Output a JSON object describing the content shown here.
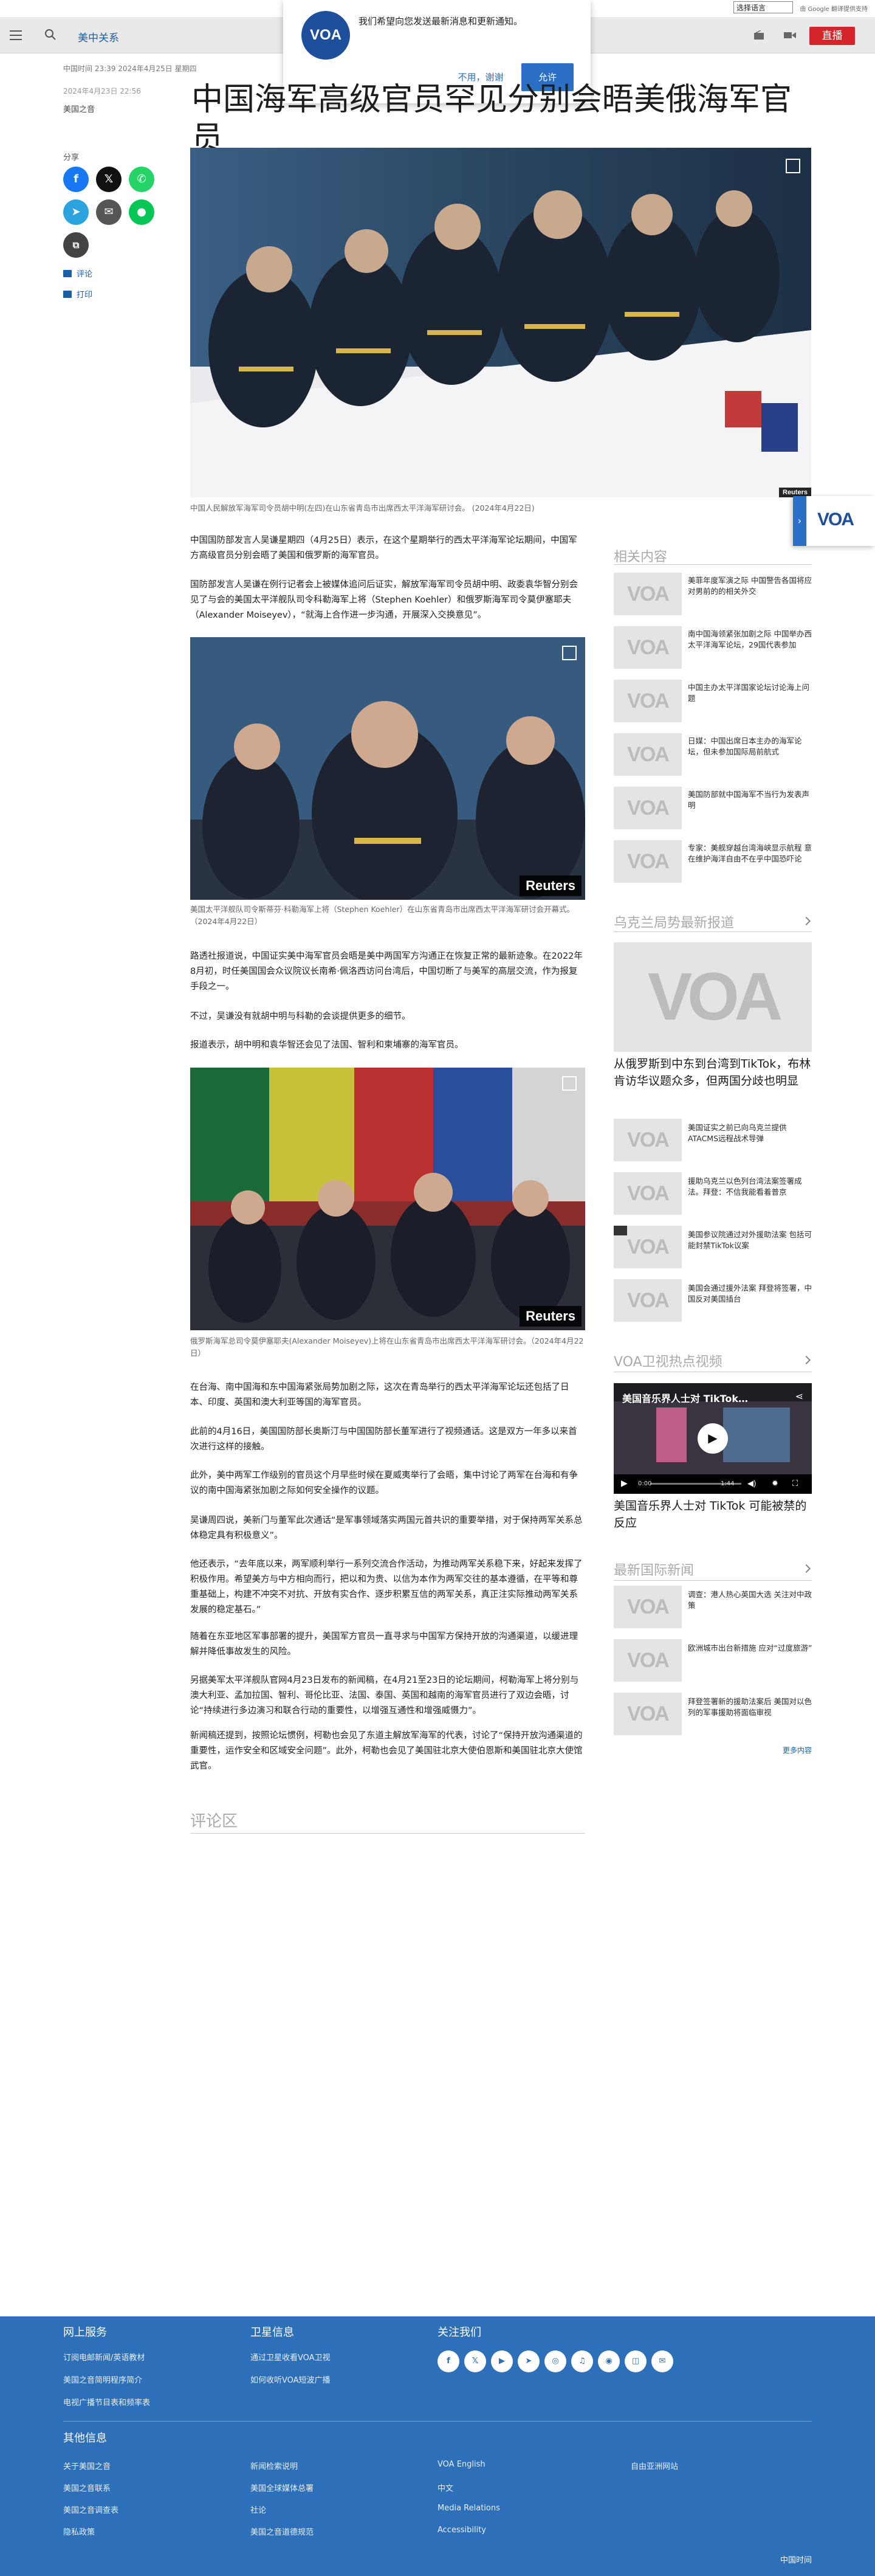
{
  "translate": {
    "select_value": "选择语言",
    "powered_text": "由 Google 翻译提供支持"
  },
  "header": {
    "section": "美中关系",
    "live_label": "直播",
    "hamburger_icon": "menu-icon",
    "search_icon": "search-icon"
  },
  "push_popup": {
    "message": "我们希望向您发送最新消息和更新通知。",
    "logo_text": "VOA",
    "deny_label": "不用，谢谢",
    "allow_label": "允许"
  },
  "article": {
    "time_line": "中国时间 23:39 2024年4月25日 星期四",
    "updated": "2024年4月23日 22:56",
    "source": "美国之音",
    "title": "中国海军高级官员罕见分别会晤美俄海军官员",
    "share_label": "分享",
    "comment_label": "评论",
    "print_label": "打印",
    "hero_caption": "中国人民解放军海军司令员胡中明(左四)在山东省青岛市出席西太平洋海军研讨会。 (2024年4月22日)",
    "paragraphs_1": [
      "中国国防部发言人吴谦星期四（4月25日）表示，在这个星期举行的西太平洋海军论坛期间，中国军方高级官员分别会晤了美国和俄罗斯的海军官员。",
      "国防部发言人吴谦在例行记者会上被媒体追问后证实，解放军海军司令员胡中明、政委袁华智分别会见了与会的美国太平洋舰队司令科勒海军上将（Stephen Koehler）和俄罗斯海军司令莫伊塞耶夫（Alexander Moiseyev），“就海上合作进一步沟通，开展深入交换意见”。"
    ],
    "image2_caption": "美国太平洋舰队司令斯蒂芬·科勒海军上将（Stephen Koehler）在山东省青岛市出席西太平洋海军研讨会开幕式。（2024年4月22日）",
    "reuters_label": "Reuters",
    "paragraphs_2": [
      "路透社报道说，中国证实美中海军官员会晤是美中两国军方沟通正在恢复正常的最新迹象。在2022年8月初，时任美国国会众议院议长南希·佩洛西访问台湾后，中国切断了与美军的高层交流，作为报复手段之一。",
      "不过，吴谦没有就胡中明与科勒的会谈提供更多的细节。",
      "报道表示，胡中明和袁华智还会见了法国、智利和柬埔寨的海军官员。"
    ],
    "image3_caption": "俄罗斯海军总司令莫伊塞耶夫(Alexander Moiseyev)上将在山东省青岛市出席西太平洋海军研讨会。（2024年4月22日）",
    "paragraphs_3": [
      "在台海、南中国海和东中国海紧张局势加剧之际，这次在青岛举行的西太平洋海军论坛还包括了日本、印度、英国和澳大利亚等国的海军官员。",
      "此前的4月16日，美国国防部长奥斯汀与中国国防部长董军进行了视频通话。这是双方一年多以来首次进行这样的接触。",
      "此外，美中两军工作级别的官员这个月早些时候在夏威夷举行了会晤，集中讨论了两军在台海和有争议的南中国海紧张加剧之际如何安全操作的议题。",
      "吴谦周四说，美新门与董军此次通话“是军事领域落实两国元首共识的重要举措，对于保持两军关系总体稳定具有积极意义”。",
      "他还表示，“去年底以来，两军顺利举行一系列交流合作活动，为推动两军关系稳下来，好起来发挥了积极作用。希望美方与中方相向而行，把以和为贵、以信为本作为两军交往的基本遵循，在平等和尊重基础上，构建不冲突不对抗、开放有实合作、逐步积累互信的两军关系，真正注实际推动两军关系发展的稳定基石。”",
      "随着在东亚地区军事部署的提升，美国军方官员一直寻求与中国军方保持开放的沟通渠道，以缓进理解并降低事故发生的风险。",
      "另据美军太平洋舰队官网4月23日发布的新闻稿，在4月21至23日的论坛期间，柯勒海军上将分别与澳大利亚、孟加拉国、智利、哥伦比亚、法国、泰国、英国和越南的海军官员进行了双边会晤，讨论“持续进行多边演习和联合行动的重要性，以增强互通性和增强威慑力”。",
      "新闻稿还提到，按照论坛惯例，柯勒也会见了东道主解放军海军的代表，讨论了“保持开放沟通渠道的重要性，运作安全和区域安全问题”。此外，柯勒也会见了美国驻北京大使伯恩斯和美国驻北京大使馆武官。"
    ],
    "comments_title": "评论区"
  },
  "rail": {
    "related_heading": "相关内容",
    "related": [
      "美菲年度军演之际 中国警告各国将应对男前的的相关外交",
      "南中国海领紧张加剧之际 中国举办西太平洋海军论坛，29国代表参加",
      "中国主办太平洋国家论坛讨论海上问题",
      "日媒：中国出席日本主办的海军论坛，但未参加国际局前航式",
      "美国防部就中国海军不当行为发表声明",
      "专家：美舰穿越台湾海峡显示航程 意在维护海洋自由不在乎中国恐吓论"
    ],
    "ukraine_heading": "乌克兰局势最新报道",
    "ukraine_big_title": "从俄罗斯到中东到台湾到TikTok，布林肯访华议题众多，但两国分歧也明显",
    "ukraine_items": [
      "美国证实之前已向乌克兰提供ATACMS远程战术导弹",
      "援助乌克兰以色列台湾法案签署成法。拜登：不信我能看着普京",
      "美国参议院通过对外援助法案 包括可能封禁TikTok议案",
      "美国会通过援外法案 拜登将签署，中国反对美国插台"
    ],
    "video_heading": "VOA卫视热点视频",
    "video_title_overlay": "美国音乐界人士对 TikTok…",
    "video_time": "0:00",
    "video_duration": "1:44",
    "video_caption": "美国音乐界人士对 TikTok 可能被禁的反应",
    "intl_heading": "最新国际新闻",
    "intl_items": [
      "调查：港人热心英国大选 关注对中政策",
      "欧洲城市出台新措施 应对“过度旅游”",
      "拜登签署新的援助法案后 美国对以色列的军事援助将面临审视"
    ],
    "more_label": "更多内容"
  },
  "side_tab": {
    "logo": "VOA",
    "arrow": "›"
  },
  "footer": {
    "col1_heading": "网上服务",
    "col1_links": [
      "订阅电邮新闻/英语教材",
      "美国之音简明程序简介",
      "电视广播节目表和频率表"
    ],
    "col2_heading": "卫星信息",
    "col2_links": [
      "通过卫星收看VOA卫视",
      "如何收听VOA短波广播"
    ],
    "col3_heading": "关注我们",
    "social_icons": [
      "facebook-icon",
      "x-icon",
      "youtube-icon",
      "telegram-icon",
      "instagram-icon",
      "podcast-icon",
      "rss-icon",
      "app-icon",
      "email-icon"
    ],
    "other_heading": "其他信息",
    "other_links": [
      [
        "关于美国之音",
        "美国之音联系",
        "美国之音调查表",
        "隐私政策"
      ],
      [
        "新闻检索说明",
        "美国全球媒体总署",
        "社论",
        "美国之音道德规范"
      ],
      [
        "VOA English",
        "中文",
        "Media Relations",
        "Accessibility"
      ],
      [
        "自由亚洲网站"
      ]
    ],
    "copyright": "中国时间"
  },
  "colors": {
    "brand_blue": "#1e4f9c",
    "link_blue": "#1a5ea8",
    "live_red": "#d3252a",
    "footer_blue": "#2d6fb8"
  }
}
